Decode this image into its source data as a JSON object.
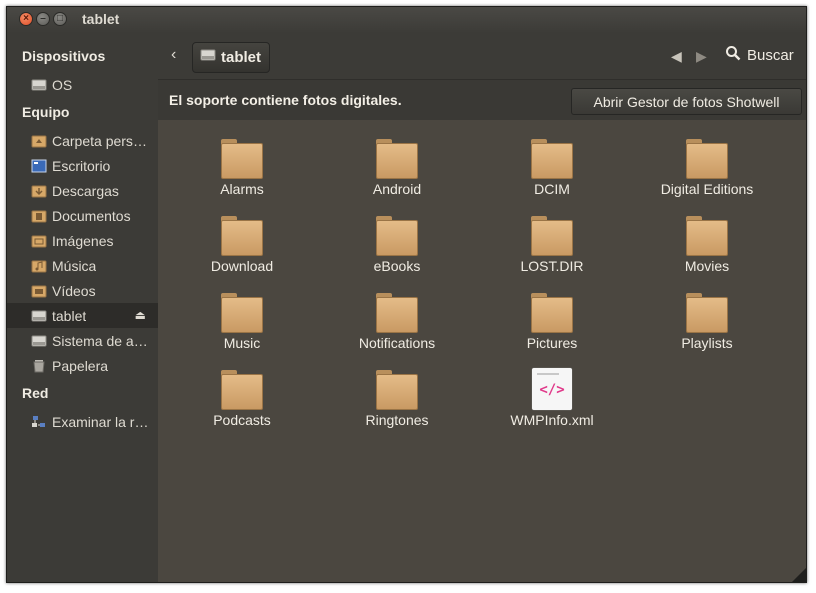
{
  "window": {
    "title": "tablet"
  },
  "sidebar": {
    "sections": [
      {
        "title": "Dispositivos"
      },
      {
        "title": "Equipo"
      },
      {
        "title": "Red"
      }
    ],
    "items": [
      {
        "label": "OS",
        "icon": "drive-icon"
      },
      {
        "label": "Carpeta personal",
        "icon": "home-folder-icon"
      },
      {
        "label": "Escritorio",
        "icon": "desktop-icon"
      },
      {
        "label": "Descargas",
        "icon": "downloads-folder-icon"
      },
      {
        "label": "Documentos",
        "icon": "documents-folder-icon"
      },
      {
        "label": "Imágenes",
        "icon": "pictures-folder-icon"
      },
      {
        "label": "Música",
        "icon": "music-folder-icon"
      },
      {
        "label": "Vídeos",
        "icon": "videos-folder-icon"
      },
      {
        "label": "tablet",
        "icon": "drive-icon",
        "active": true
      },
      {
        "label": "Sistema de archivos",
        "icon": "drive-icon"
      },
      {
        "label": "Papelera",
        "icon": "trash-icon"
      },
      {
        "label": "Examinar la red",
        "icon": "network-icon"
      }
    ]
  },
  "toolbar": {
    "path_label": "tablet",
    "search_label": "Buscar"
  },
  "infobar": {
    "message": "El soporte contiene fotos digitales.",
    "button_label": "Abrir Gestor de fotos Shotwell"
  },
  "files": [
    {
      "name": "Alarms",
      "type": "folder"
    },
    {
      "name": "Android",
      "type": "folder"
    },
    {
      "name": "DCIM",
      "type": "folder"
    },
    {
      "name": "Digital Editions",
      "type": "folder"
    },
    {
      "name": "Download",
      "type": "folder"
    },
    {
      "name": "eBooks",
      "type": "folder"
    },
    {
      "name": "LOST.DIR",
      "type": "folder"
    },
    {
      "name": "Movies",
      "type": "folder"
    },
    {
      "name": "Music",
      "type": "folder"
    },
    {
      "name": "Notifications",
      "type": "folder"
    },
    {
      "name": "Pictures",
      "type": "folder"
    },
    {
      "name": "Playlists",
      "type": "folder"
    },
    {
      "name": "Podcasts",
      "type": "folder"
    },
    {
      "name": "Ringtones",
      "type": "folder"
    },
    {
      "name": "WMPInfo.xml",
      "type": "xml",
      "glyph": "</>"
    }
  ],
  "colors": {
    "window_bg": "#3c3b37",
    "content_bg": "#4b4740",
    "folder": "#d8ac74",
    "close_button": "#e0502b",
    "xml_accent": "#e0398a"
  }
}
